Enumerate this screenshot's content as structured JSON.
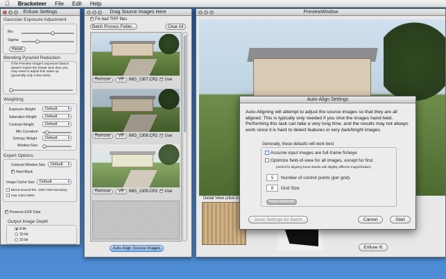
{
  "menubar": {
    "app": "Bracketeer",
    "items": [
      "File",
      "Edit",
      "Help"
    ]
  },
  "enfuse": {
    "title": "Enfuse Settings",
    "gaussian_label": "Gaussian Exposure Adjustment",
    "mu_label": "Mu",
    "sigma_label": "Sigma",
    "mu_value": 0.5,
    "sigma_value": 0.3,
    "reset_label": "Reset",
    "blending_label": "Blending Pyramid Reduction",
    "blending_help": "If the Preview image's exposure blance doesn't match the Detail view then you may need to adjust this value up (generally only a few ticks).",
    "weighting_label": "Weighting",
    "exposure_weight_label": "Exposure Weight",
    "saturation_weight_label": "Saturation Weight",
    "contrast_weight_label": "Contrast Weight",
    "min_curvature_label": "Min Curvature:",
    "entropy_weight_label": "Entropy Weight",
    "window_size_label": "Window Size:",
    "default_option": "Default",
    "expert_label": "Expert Options",
    "contrast_window_label": "Contrast Window Size",
    "hard_mask_label": "Hard Mask",
    "image_cache_label": "Image Cache Size",
    "blend_boundary_label": "Blend around the -180/+180 boundary",
    "ciecam_label": "Use CIECAM02",
    "preserve_exif_label": "Preserve EXIF Data",
    "output_depth_label": "Output Image Depth",
    "depth_options": [
      "8-bit",
      "16-bit",
      "32-bit"
    ]
  },
  "drag": {
    "title": "Drag Source Images Here",
    "fix_tiff_label": "Fix bad TIFF files",
    "batch_label": "Batch Process Folder...",
    "clear_label": "Clear All",
    "remove_label": "Remove",
    "vr_label": "VR",
    "use_label": "Use",
    "images": [
      {
        "name": "IMG_1307.CR2"
      },
      {
        "name": "IMG_1308.CR2"
      },
      {
        "name": "IMG_1309.CR2"
      }
    ],
    "auto_align_label": "Auto Align Source Images"
  },
  "preview": {
    "title": "PreviewWindow",
    "detail_label": "Detail View (click in",
    "enfuse_button": "Enfuse It!"
  },
  "dialog": {
    "title": "Auto-Align Settings",
    "description": "Auto-Aligning will attempt to adjust the source images so that they are all aligned.  This is typically only needed if you shot the images hand-held. Performing this task can take a very long time, and the results may not always work since it is hard to detect features in very dark/bright images.",
    "defaults_label": "Generally, these defaults will work best",
    "fisheye_label": "Assume input images are full-frame fisheye",
    "optimize_label": "Optimize field-of-view for all images, except for first.",
    "optimize_note": "(useful for aligning focus stacks with slightly different magnification).",
    "control_points_value": "5",
    "control_points_label": "Number of control points (per grid).",
    "grid_size_value": "8",
    "grid_size_label": "Grid Size",
    "reset_defaults_label": "Reset Defaults",
    "store_label": "Store Settings for Batch",
    "cancel_label": "Cancel",
    "start_label": "Start"
  }
}
